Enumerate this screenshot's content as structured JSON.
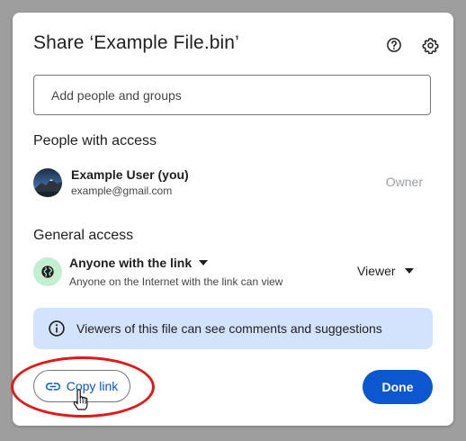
{
  "dialog": {
    "title": "Share ‘Example File.bin’",
    "help_icon": "help-circle-icon",
    "settings_icon": "gear-icon"
  },
  "add_people": {
    "value": "",
    "placeholder": "Add people and groups"
  },
  "people_with_access": {
    "heading": "People with access",
    "users": [
      {
        "name": "Example User (you)",
        "email": "example@gmail.com",
        "role": "Owner"
      }
    ]
  },
  "general_access": {
    "heading": "General access",
    "icon": "globe-icon",
    "selected": "Anyone with the link",
    "description": "Anyone on the Internet with the link can view",
    "role": "Viewer"
  },
  "info_banner": {
    "icon": "info-icon",
    "text": "Viewers of this file can see comments and suggestions"
  },
  "footer": {
    "copy_link_label": "Copy link",
    "copy_link_icon": "link-icon",
    "done_label": "Done"
  },
  "colors": {
    "primary": "#0b57d0",
    "info_bg": "#d3e3fd",
    "globe_bg": "#c4eed0",
    "annotation": "#e01a1a"
  }
}
